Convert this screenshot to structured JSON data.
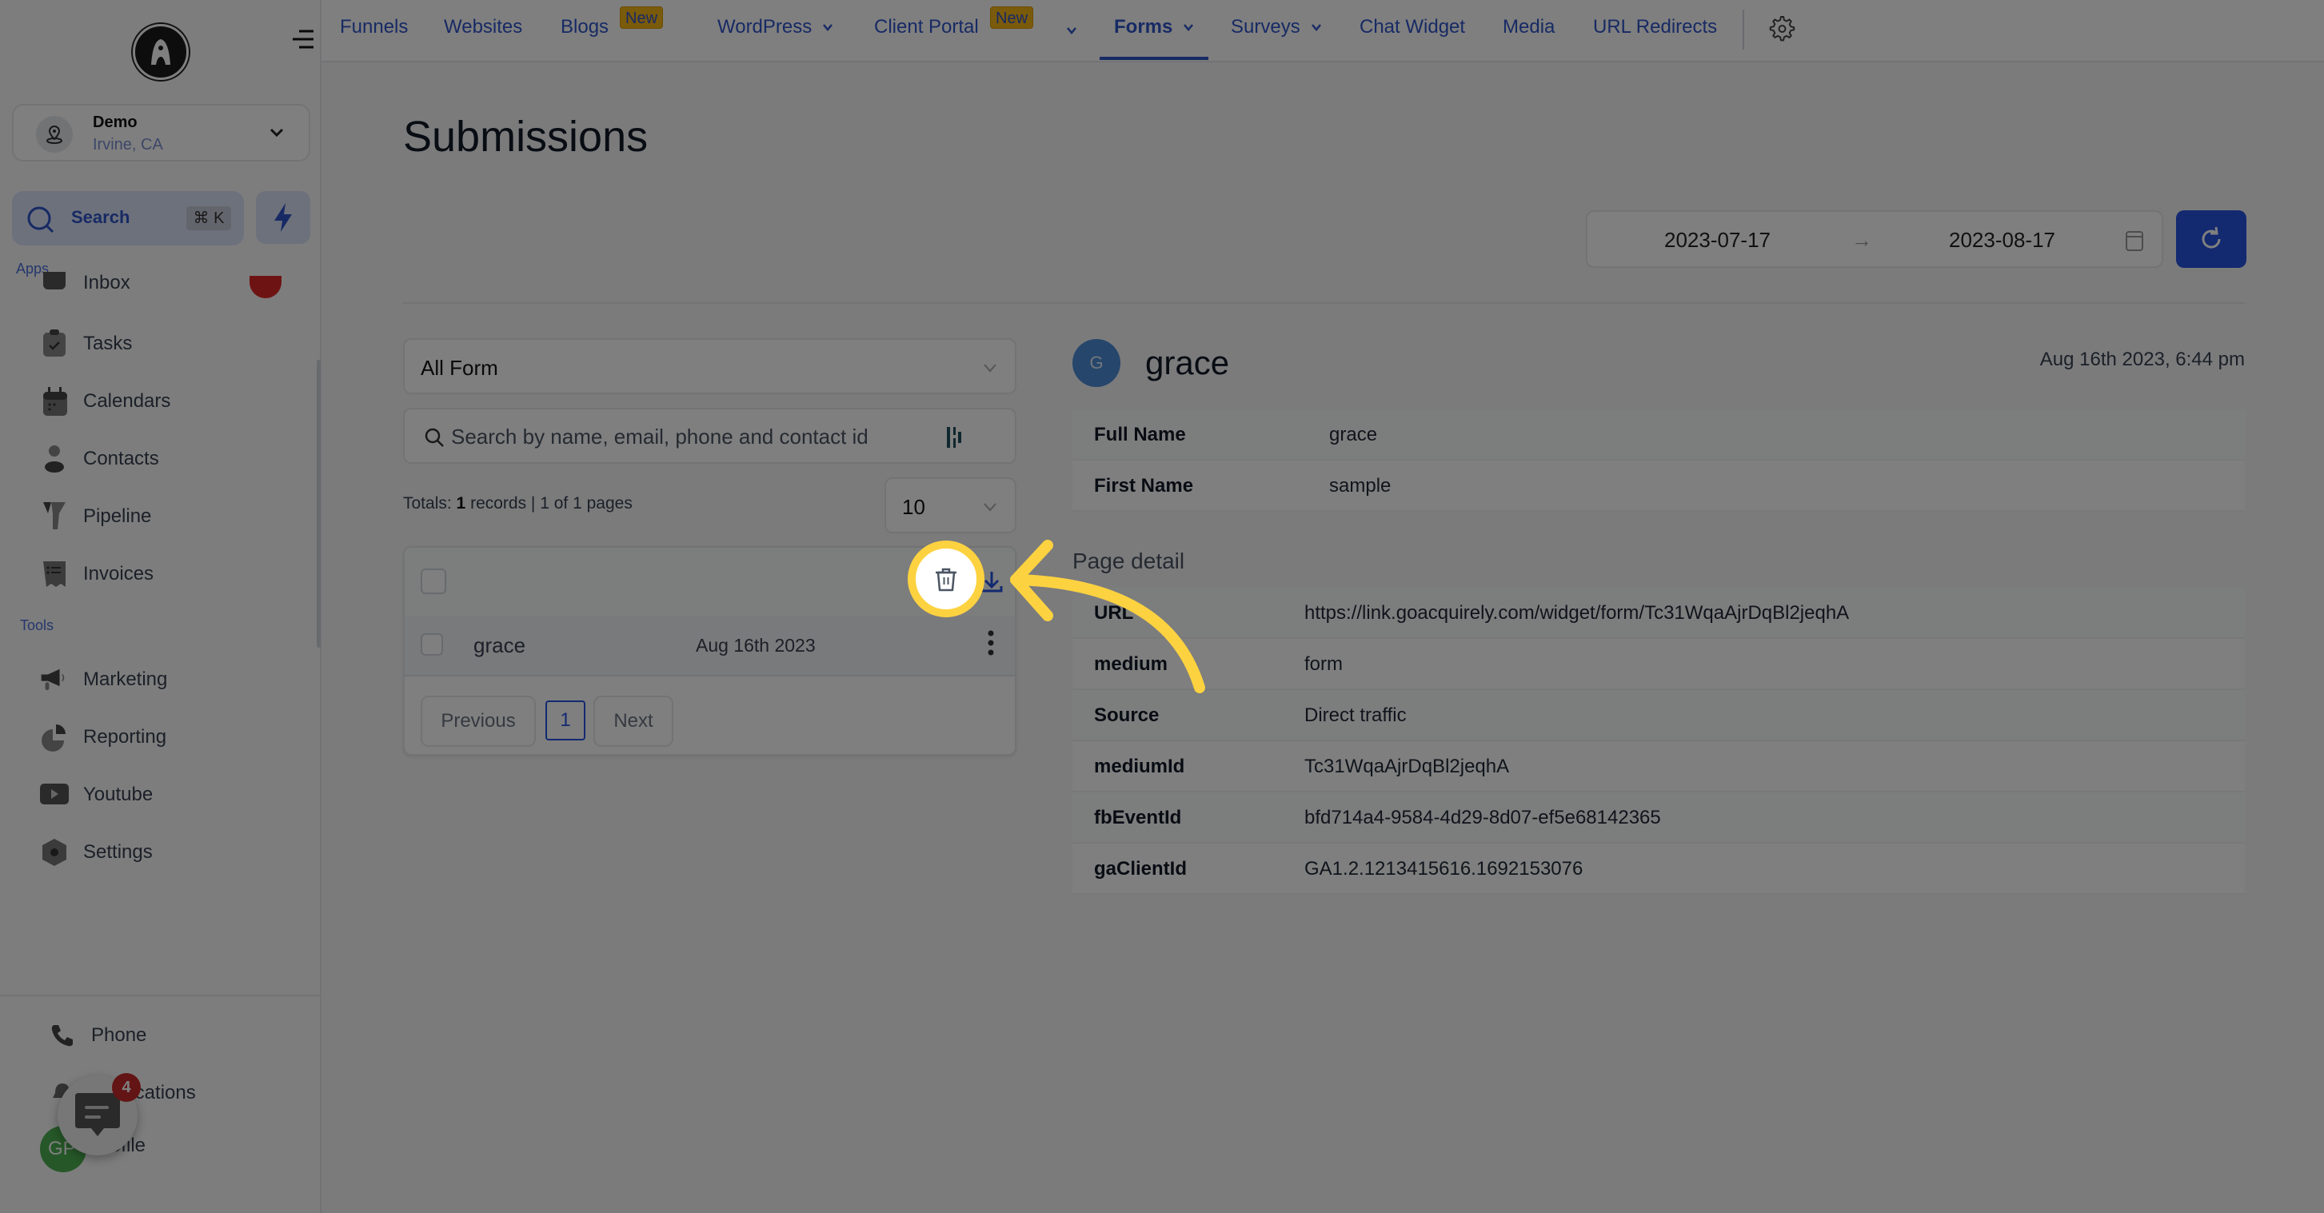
{
  "sidebar": {
    "location": {
      "name": "Demo",
      "subtitle": "Irvine, CA"
    },
    "search": {
      "label": "Search",
      "shortcut": "⌘ K"
    },
    "apps_label": "Apps",
    "tools_label": "Tools",
    "apps": [
      {
        "label": "Inbox",
        "icon": "inbox-icon"
      },
      {
        "label": "Tasks",
        "icon": "tasks-icon"
      },
      {
        "label": "Calendars",
        "icon": "calendar-icon"
      },
      {
        "label": "Contacts",
        "icon": "contacts-icon"
      },
      {
        "label": "Pipeline",
        "icon": "pipeline-icon"
      },
      {
        "label": "Invoices",
        "icon": "invoices-icon"
      }
    ],
    "tools": [
      {
        "label": "Marketing",
        "icon": "megaphone-icon"
      },
      {
        "label": "Reporting",
        "icon": "pie-chart-icon"
      },
      {
        "label": "Youtube",
        "icon": "youtube-icon"
      },
      {
        "label": "Settings",
        "icon": "settings-icon"
      }
    ],
    "footer": [
      {
        "label": "Phone",
        "icon": "phone-icon"
      },
      {
        "label": "Notifications",
        "icon": "bell-icon"
      },
      {
        "label": "Profile",
        "icon": "avatar"
      }
    ],
    "chat_badge": "4",
    "profile_initials": "GP"
  },
  "topnav": {
    "tabs": [
      {
        "label": "Funnels"
      },
      {
        "label": "Websites"
      },
      {
        "label": "Blogs",
        "badge": "New"
      },
      {
        "label": "WordPress"
      },
      {
        "label": "Client Portal",
        "badge": "New"
      },
      {
        "label": "Forms",
        "active": true
      },
      {
        "label": "Surveys"
      },
      {
        "label": "Chat Widget"
      },
      {
        "label": "Media"
      },
      {
        "label": "URL Redirects"
      }
    ]
  },
  "page": {
    "title": "Submissions",
    "date_from": "2023-07-17",
    "date_to": "2023-08-17",
    "date_arrow": "→"
  },
  "filters": {
    "form_select": "All Form",
    "search_placeholder": "Search by name, email, phone and contact id",
    "totals_prefix": "Totals:",
    "totals_count": "1",
    "totals_suffix": "records | 1 of 1 pages",
    "page_size": "10"
  },
  "submissions": [
    {
      "name": "grace",
      "date": "Aug 16th 2023"
    }
  ],
  "pagination": {
    "previous": "Previous",
    "current": "1",
    "next": "Next"
  },
  "detail": {
    "avatar_initial": "G",
    "name": "grace",
    "timestamp": "Aug 16th 2023, 6:44 pm",
    "fields": [
      {
        "key": "Full Name",
        "value": "grace"
      },
      {
        "key": "First Name",
        "value": "sample"
      }
    ],
    "page_detail_title": "Page detail",
    "page_detail": [
      {
        "key": "URL",
        "value": "https://link.goacquirely.com/widget/form/Tc31WqaAjrDqBl2jeqhA"
      },
      {
        "key": "medium",
        "value": "form"
      },
      {
        "key": "Source",
        "value": "Direct traffic"
      },
      {
        "key": "mediumId",
        "value": "Tc31WqaAjrDqBl2jeqhA"
      },
      {
        "key": "fbEventId",
        "value": "bfd714a4-9584-4d29-8d07-ef5e68142365"
      },
      {
        "key": "gaClientId",
        "value": "GA1.2.1213415616.1692153076"
      }
    ]
  },
  "colors": {
    "accent": "#2752e0",
    "highlight": "#fdd240",
    "new_badge": "#f5b417"
  }
}
